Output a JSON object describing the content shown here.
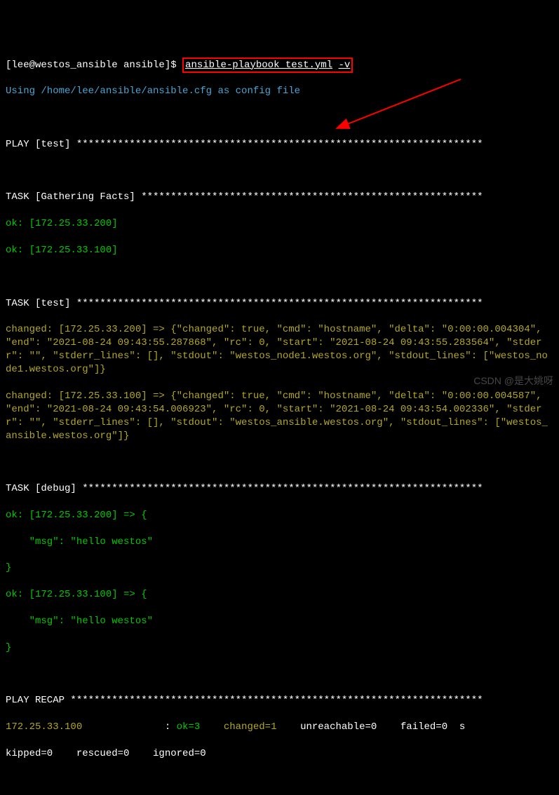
{
  "prompt": {
    "user_host": "[lee@westos_ansible ansible]$",
    "command_base": "ansible-playbook test.yml",
    "command_flag": "-v"
  },
  "config_line": "Using /home/lee/ansible/ansible.cfg as config file",
  "sections": {
    "play_header": "PLAY [test] *********************************************************************",
    "gathering_header": "TASK [Gathering Facts] **********************************************************",
    "gathering_ok1": "ok: [172.25.33.200]",
    "gathering_ok2": "ok: [172.25.33.100]",
    "task_test_header": "TASK [test] *********************************************************************",
    "task_test_changed1": "changed: [172.25.33.200] => {\"changed\": true, \"cmd\": \"hostname\", \"delta\": \"0:00:00.004304\", \"end\": \"2021-08-24 09:43:55.287868\", \"rc\": 0, \"start\": \"2021-08-24 09:43:55.283564\", \"stderr\": \"\", \"stderr_lines\": [], \"stdout\": \"westos_node1.westos.org\", \"stdout_lines\": [\"westos_node1.westos.org\"]}",
    "task_test_changed2": "changed: [172.25.33.100] => {\"changed\": true, \"cmd\": \"hostname\", \"delta\": \"0:00:00.004587\", \"end\": \"2021-08-24 09:43:54.006923\", \"rc\": 0, \"start\": \"2021-08-24 09:43:54.002336\", \"stderr\": \"\", \"stderr_lines\": [], \"stdout\": \"westos_ansible.westos.org\", \"stdout_lines\": [\"westos_ansible.westos.org\"]}",
    "task_debug_header": "TASK [debug] ********************************************************************",
    "debug_ok1_line1": "ok: [172.25.33.200] => {",
    "debug_ok1_line2": "    \"msg\": \"hello westos\"",
    "debug_ok1_line3": "}",
    "debug_ok2_line1": "ok: [172.25.33.100] => {",
    "debug_ok2_line2": "    \"msg\": \"hello westos\"",
    "debug_ok2_line3": "}",
    "recap_header": "PLAY RECAP **********************************************************************",
    "recap_host": "172.25.33.100",
    "recap_sep": "              : ",
    "recap_ok": "ok=3   ",
    "recap_changed": " changed=1   ",
    "recap_rest": " unreachable=0    failed=0  s",
    "recap_line2": "kipped=0    rescued=0    ignored=0"
  },
  "watermark": "CSDN @是大姚呀"
}
